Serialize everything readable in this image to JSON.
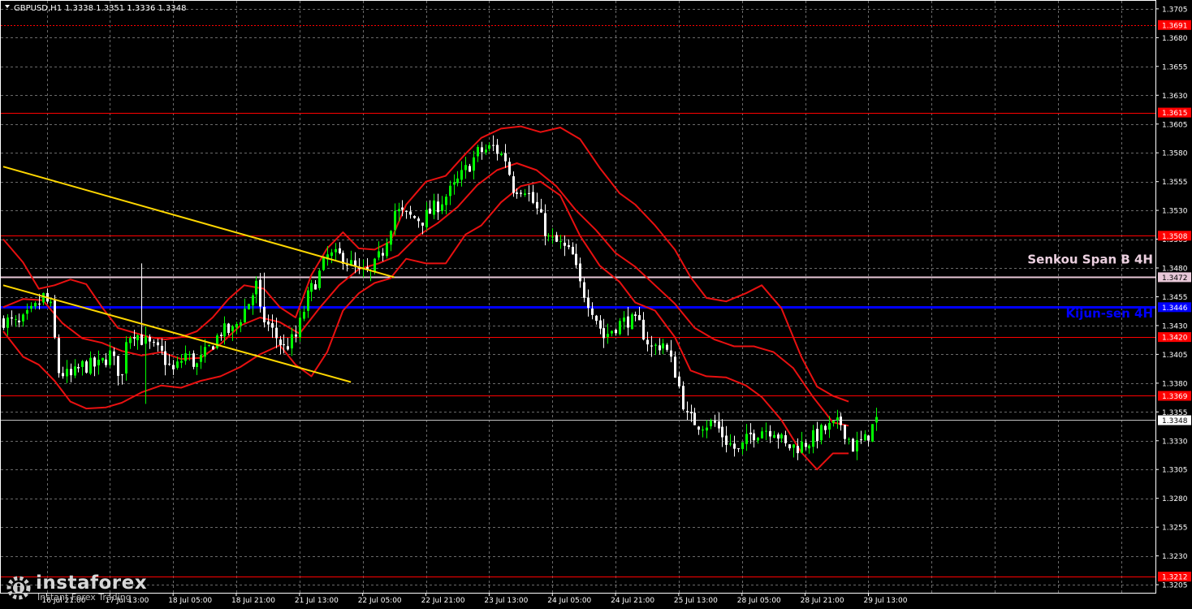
{
  "header": {
    "symbol": "GBPUSD,H1",
    "ohlc": "1.3338 1.3351 1.3336 1.3348"
  },
  "watermark": {
    "brand": "instaforex",
    "tagline": "Instant Forex Trading"
  },
  "chart_data": {
    "type": "candlestick",
    "ylim": [
      1.3198,
      1.3712
    ],
    "y_ticks": [
      "1.3205",
      "1.3230",
      "1.3255",
      "1.3280",
      "1.3305",
      "1.3330",
      "1.3355",
      "1.3380",
      "1.3405",
      "1.3430",
      "1.3455",
      "1.3480",
      "1.3505",
      "1.3530",
      "1.3555",
      "1.3580",
      "1.3605",
      "1.3630",
      "1.3655",
      "1.3680",
      "1.3705"
    ],
    "x_labels": [
      {
        "bar": 11,
        "label": "16 Jul 21:00"
      },
      {
        "bar": 27,
        "label": "17 Jul 13:00"
      },
      {
        "bar": 43,
        "label": "18 Jul 05:00"
      },
      {
        "bar": 59,
        "label": "18 Jul 21:00"
      },
      {
        "bar": 75,
        "label": "21 Jul 13:00"
      },
      {
        "bar": 91,
        "label": "22 Jul 05:00"
      },
      {
        "bar": 107,
        "label": "22 Jul 21:00"
      },
      {
        "bar": 123,
        "label": "23 Jul 13:00"
      },
      {
        "bar": 139,
        "label": "24 Jul 05:00"
      },
      {
        "bar": 155,
        "label": "24 Jul 21:00"
      },
      {
        "bar": 171,
        "label": "25 Jul 13:00"
      },
      {
        "bar": 187,
        "label": "28 Jul 05:00"
      },
      {
        "bar": 203,
        "label": "28 Jul 21:00"
      },
      {
        "bar": 219,
        "label": "29 Jul 13:00"
      }
    ],
    "total_bars": 222,
    "bars_in_view": 350,
    "colors": {
      "bull": "#00ff00",
      "bear": "#ffffff",
      "grid": "#6a6a6a",
      "axis_text": "#ffffff",
      "price_line": "#c0c0c0"
    },
    "horizontal_levels": [
      {
        "price": 1.3691,
        "label": "1.3691",
        "color": "#ff0000",
        "dashed": true
      },
      {
        "price": 1.3615,
        "label": "1.3615",
        "color": "#ff0000",
        "dashed": false
      },
      {
        "price": 1.3508,
        "label": "1.3508",
        "color": "#ff0000",
        "dashed": false
      },
      {
        "price": 1.3472,
        "label": "1.3472",
        "color": "#e8c8d8",
        "dashed": false,
        "width": 2
      },
      {
        "price": 1.3446,
        "label": "1.3446",
        "color": "#0000ff",
        "dashed": false,
        "width": 3
      },
      {
        "price": 1.342,
        "label": "1.3420",
        "color": "#ff0000",
        "dashed": false
      },
      {
        "price": 1.3369,
        "label": "1.3369",
        "color": "#ff0000",
        "dashed": false
      },
      {
        "price": 1.3212,
        "label": "1.3212",
        "color": "#ff0000",
        "dashed": false
      }
    ],
    "current_price": {
      "price": 1.3348,
      "label": "1.3348"
    },
    "annotations": [
      {
        "text": "Senkou Span B 4H",
        "price": 1.3484,
        "color": "#ecd0e0"
      },
      {
        "text": "Kijun-sen 4H",
        "price": 1.3437,
        "color": "#0000ff"
      }
    ],
    "trendlines": [
      {
        "name": "upper-trendline",
        "color": "#ffd700",
        "x1": 0,
        "y1": 1.3568,
        "x2": 99,
        "y2": 1.3472
      },
      {
        "name": "lower-trendline",
        "color": "#ffd700",
        "x1": 0,
        "y1": 1.3465,
        "x2": 88,
        "y2": 1.3381
      }
    ],
    "close_path": [
      [
        0,
        1.3435
      ],
      [
        4,
        1.343
      ],
      [
        8,
        1.3445
      ],
      [
        10,
        1.3455
      ],
      [
        12,
        1.3445
      ],
      [
        14,
        1.339
      ],
      [
        17,
        1.3385
      ],
      [
        20,
        1.3395
      ],
      [
        24,
        1.3395
      ],
      [
        27,
        1.3405
      ],
      [
        30,
        1.3385
      ],
      [
        31,
        1.342
      ],
      [
        33,
        1.3425
      ],
      [
        36,
        1.3415
      ],
      [
        40,
        1.3405
      ],
      [
        43,
        1.339
      ],
      [
        46,
        1.3405
      ],
      [
        49,
        1.3395
      ],
      [
        52,
        1.341
      ],
      [
        55,
        1.3425
      ],
      [
        58,
        1.3425
      ],
      [
        62,
        1.345
      ],
      [
        64,
        1.3465
      ],
      [
        65,
        1.344
      ],
      [
        68,
        1.3425
      ],
      [
        71,
        1.341
      ],
      [
        74,
        1.342
      ],
      [
        77,
        1.3455
      ],
      [
        80,
        1.3475
      ],
      [
        82,
        1.349
      ],
      [
        86,
        1.349
      ],
      [
        90,
        1.3475
      ],
      [
        93,
        1.3475
      ],
      [
        96,
        1.3495
      ],
      [
        99,
        1.353
      ],
      [
        102,
        1.3525
      ],
      [
        106,
        1.3522
      ],
      [
        110,
        1.3535
      ],
      [
        114,
        1.355
      ],
      [
        117,
        1.3565
      ],
      [
        120,
        1.358
      ],
      [
        124,
        1.3585
      ],
      [
        127,
        1.3575
      ],
      [
        129,
        1.355
      ],
      [
        132,
        1.355
      ],
      [
        135,
        1.353
      ],
      [
        138,
        1.3505
      ],
      [
        141,
        1.35
      ],
      [
        144,
        1.349
      ],
      [
        146,
        1.3465
      ],
      [
        149,
        1.3445
      ],
      [
        152,
        1.342
      ],
      [
        155,
        1.343
      ],
      [
        158,
        1.3435
      ],
      [
        161,
        1.343
      ],
      [
        164,
        1.341
      ],
      [
        167,
        1.3415
      ],
      [
        170,
        1.339
      ],
      [
        173,
        1.335
      ],
      [
        176,
        1.3345
      ],
      [
        180,
        1.3345
      ],
      [
        183,
        1.333
      ],
      [
        186,
        1.332
      ],
      [
        189,
        1.3335
      ],
      [
        192,
        1.334
      ],
      [
        195,
        1.334
      ],
      [
        198,
        1.3325
      ],
      [
        201,
        1.3325
      ],
      [
        204,
        1.333
      ],
      [
        208,
        1.334
      ],
      [
        212,
        1.3345
      ],
      [
        215,
        1.3325
      ],
      [
        218,
        1.333
      ],
      [
        221,
        1.3348
      ]
    ],
    "spike_bars": {
      "35": 1.3484,
      "36": 1.3362,
      "65": 1.3475,
      "66": 1.3476
    },
    "bollinger": {
      "upper": [
        [
          0,
          1.3505
        ],
        [
          5,
          1.3485
        ],
        [
          9,
          1.3462
        ],
        [
          13,
          1.3465
        ],
        [
          17,
          1.347
        ],
        [
          21,
          1.3466
        ],
        [
          25,
          1.3446
        ],
        [
          29,
          1.3428
        ],
        [
          33,
          1.3424
        ],
        [
          37,
          1.342
        ],
        [
          41,
          1.3418
        ],
        [
          45,
          1.342
        ],
        [
          49,
          1.3425
        ],
        [
          53,
          1.3437
        ],
        [
          57,
          1.3453
        ],
        [
          61,
          1.3465
        ],
        [
          66,
          1.3462
        ],
        [
          70,
          1.3446
        ],
        [
          74,
          1.3437
        ],
        [
          78,
          1.3474
        ],
        [
          82,
          1.3497
        ],
        [
          86,
          1.3511
        ],
        [
          90,
          1.3497
        ],
        [
          94,
          1.3496
        ],
        [
          98,
          1.3503
        ],
        [
          102,
          1.3535
        ],
        [
          107,
          1.3555
        ],
        [
          112,
          1.356
        ],
        [
          117,
          1.3579
        ],
        [
          121,
          1.3593
        ],
        [
          126,
          1.3601
        ],
        [
          131,
          1.3603
        ],
        [
          136,
          1.3598
        ],
        [
          141,
          1.3602
        ],
        [
          146,
          1.3592
        ],
        [
          151,
          1.3567
        ],
        [
          156,
          1.3545
        ],
        [
          160,
          1.3535
        ],
        [
          165,
          1.3517
        ],
        [
          170,
          1.3496
        ],
        [
          174,
          1.3472
        ],
        [
          178,
          1.3454
        ],
        [
          183,
          1.3451
        ],
        [
          188,
          1.3458
        ],
        [
          192,
          1.3465
        ],
        [
          197,
          1.3445
        ],
        [
          202,
          1.3403
        ],
        [
          206,
          1.3377
        ],
        [
          210,
          1.3369
        ],
        [
          214,
          1.3364
        ]
      ],
      "middle": [
        [
          0,
          1.3446
        ],
        [
          5,
          1.3453
        ],
        [
          10,
          1.3452
        ],
        [
          15,
          1.3432
        ],
        [
          20,
          1.3419
        ],
        [
          25,
          1.3415
        ],
        [
          30,
          1.3408
        ],
        [
          35,
          1.3404
        ],
        [
          40,
          1.3407
        ],
        [
          45,
          1.3401
        ],
        [
          50,
          1.3402
        ],
        [
          55,
          1.3414
        ],
        [
          60,
          1.343
        ],
        [
          65,
          1.3437
        ],
        [
          70,
          1.3433
        ],
        [
          75,
          1.3423
        ],
        [
          80,
          1.3445
        ],
        [
          85,
          1.3465
        ],
        [
          90,
          1.3479
        ],
        [
          95,
          1.3484
        ],
        [
          100,
          1.3491
        ],
        [
          105,
          1.3508
        ],
        [
          110,
          1.3519
        ],
        [
          115,
          1.3533
        ],
        [
          120,
          1.3552
        ],
        [
          125,
          1.3565
        ],
        [
          130,
          1.3571
        ],
        [
          135,
          1.3565
        ],
        [
          140,
          1.3551
        ],
        [
          145,
          1.353
        ],
        [
          150,
          1.3513
        ],
        [
          155,
          1.3493
        ],
        [
          160,
          1.3481
        ],
        [
          165,
          1.3465
        ],
        [
          170,
          1.3449
        ],
        [
          175,
          1.3428
        ],
        [
          180,
          1.3418
        ],
        [
          185,
          1.3412
        ],
        [
          190,
          1.3412
        ],
        [
          195,
          1.3407
        ],
        [
          200,
          1.3393
        ],
        [
          205,
          1.3368
        ],
        [
          210,
          1.3346
        ],
        [
          214,
          1.3343
        ]
      ],
      "lower": [
        [
          0,
          1.3425
        ],
        [
          5,
          1.3403
        ],
        [
          9,
          1.3396
        ],
        [
          13,
          1.3382
        ],
        [
          17,
          1.3364
        ],
        [
          21,
          1.3358
        ],
        [
          26,
          1.3359
        ],
        [
          30,
          1.3363
        ],
        [
          35,
          1.3372
        ],
        [
          40,
          1.3378
        ],
        [
          45,
          1.3376
        ],
        [
          50,
          1.3382
        ],
        [
          55,
          1.3386
        ],
        [
          60,
          1.3394
        ],
        [
          65,
          1.3405
        ],
        [
          70,
          1.3413
        ],
        [
          74,
          1.3396
        ],
        [
          78,
          1.3386
        ],
        [
          82,
          1.3407
        ],
        [
          86,
          1.3443
        ],
        [
          90,
          1.3458
        ],
        [
          94,
          1.3467
        ],
        [
          98,
          1.3471
        ],
        [
          102,
          1.3488
        ],
        [
          107,
          1.3484
        ],
        [
          112,
          1.3484
        ],
        [
          117,
          1.3509
        ],
        [
          121,
          1.3517
        ],
        [
          126,
          1.3537
        ],
        [
          131,
          1.3551
        ],
        [
          136,
          1.3555
        ],
        [
          141,
          1.3543
        ],
        [
          146,
          1.3508
        ],
        [
          151,
          1.3482
        ],
        [
          156,
          1.3468
        ],
        [
          160,
          1.345
        ],
        [
          165,
          1.3443
        ],
        [
          170,
          1.342
        ],
        [
          174,
          1.3391
        ],
        [
          178,
          1.3386
        ],
        [
          183,
          1.3385
        ],
        [
          188,
          1.3378
        ],
        [
          192,
          1.3368
        ],
        [
          197,
          1.3348
        ],
        [
          202,
          1.332
        ],
        [
          206,
          1.3305
        ],
        [
          210,
          1.3319
        ],
        [
          214,
          1.3319
        ]
      ]
    }
  }
}
